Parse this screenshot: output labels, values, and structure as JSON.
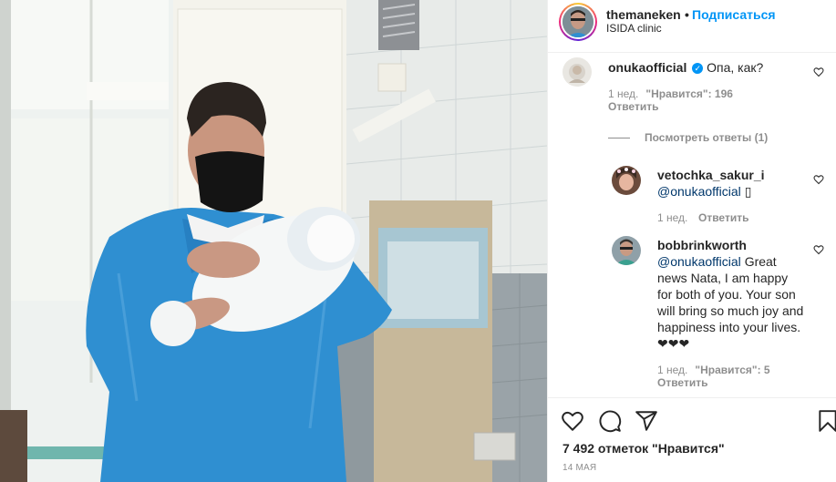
{
  "post": {
    "username": "themaneken",
    "dot": "•",
    "follow_label": "Подписаться",
    "location": "ISIDA clinic"
  },
  "comments": [
    {
      "username": "onukaofficial",
      "verified": true,
      "text": "Опа, как?",
      "time": "1 нед.",
      "likes": "\"Нравится\": 196",
      "reply_label": "Ответить",
      "view_replies": "Посмотреть ответы (1)"
    }
  ],
  "replies": [
    {
      "username": "vetochka_sakur_i",
      "mention": "@onukaofficial",
      "text": "▯",
      "time": "1 нед.",
      "reply_label": "Ответить"
    },
    {
      "username": "bobbrinkworth",
      "mention": "@onukaofficial",
      "text": "Great news Nata, I am happy for both of you. Your son will bring so much joy and happiness into your lives. ❤❤❤",
      "time": "1 нед.",
      "likes": "\"Нравится\": 5",
      "reply_label": "Ответить"
    }
  ],
  "footer": {
    "likes_count": "7 492 отметок \"Нравится\"",
    "date": "14 МАЯ"
  },
  "icons": {
    "like": "heart-icon",
    "comment": "comment-icon",
    "share": "share-icon",
    "save": "bookmark-icon",
    "comment_like": "heart-icon"
  },
  "colors": {
    "link_blue": "#0095f6",
    "mention": "#00376b",
    "muted": "#8e8e8e",
    "border": "#efefef",
    "text": "#262626"
  }
}
